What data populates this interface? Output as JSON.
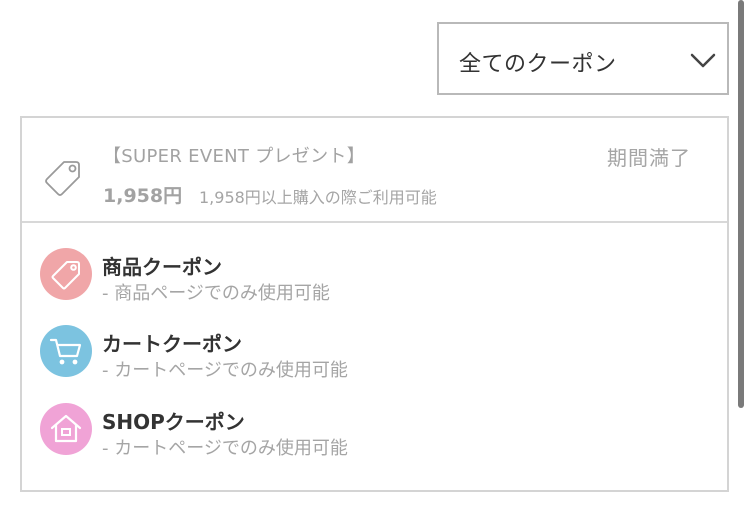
{
  "filter": {
    "selected": "全てのクーポン",
    "icon": "chevron-down-icon"
  },
  "coupon": {
    "title": "【SUPER EVENT プレゼント】",
    "status": "期間満了",
    "amount": "1,958円",
    "condition": "1,958円以上購入の際ご利用可能",
    "icon": "tag-icon"
  },
  "legend": [
    {
      "title": "商品クーポン",
      "desc": "- 商品ページでのみ使用可能",
      "icon": "tag-icon",
      "color": "#f0a6a8"
    },
    {
      "title": "カートクーポン",
      "desc": "- カートページでのみ使用可能",
      "icon": "cart-icon",
      "color": "#7cc3e0"
    },
    {
      "title": "SHOPクーポン",
      "desc": "- カートページでのみ使用可能",
      "icon": "house-icon",
      "color": "#f0a3d6"
    }
  ]
}
